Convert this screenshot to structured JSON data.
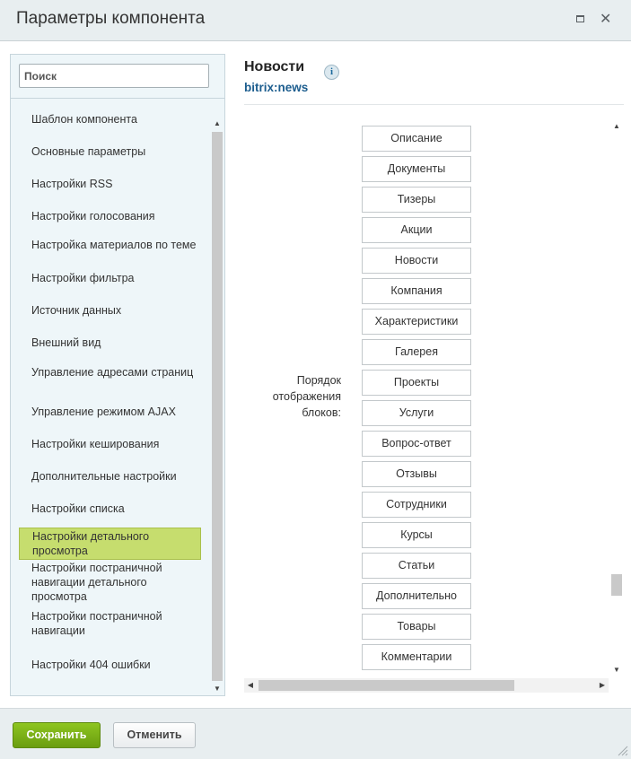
{
  "window": {
    "title": "Параметры компонента"
  },
  "sidebar": {
    "search_placeholder": "Поиск",
    "items": [
      {
        "label": "Шаблон компонента"
      },
      {
        "label": "Основные параметры"
      },
      {
        "label": "Настройки RSS"
      },
      {
        "label": "Настройки голосования"
      },
      {
        "label": "Настройка материалов по теме"
      },
      {
        "label": "Настройки фильтра"
      },
      {
        "label": "Источник данных"
      },
      {
        "label": "Внешний вид"
      },
      {
        "label": "Управление адресами страниц"
      },
      {
        "label": "Управление режимом AJAX"
      },
      {
        "label": "Настройки кеширования"
      },
      {
        "label": "Дополнительные настройки"
      },
      {
        "label": "Настройки списка"
      },
      {
        "label": "Настройки детального просмотра",
        "active": true
      },
      {
        "label": "Настройки постраничной навигации детального просмотра"
      },
      {
        "label": "Настройки постраничной навигации"
      },
      {
        "label": "Настройки 404 ошибки"
      }
    ]
  },
  "main": {
    "title": "Новости",
    "subtitle": "bitrix:news",
    "info_icon": "info-icon",
    "block_order_label": "Порядок отображения блоков:",
    "blocks": [
      "Описание",
      "Документы",
      "Тизеры",
      "Акции",
      "Новости",
      "Компания",
      "Характеристики",
      "Галерея",
      "Проекты",
      "Услуги",
      "Вопрос-ответ",
      "Отзывы",
      "Сотрудники",
      "Курсы",
      "Статьи",
      "Дополнительно",
      "Товары",
      "Комментарии"
    ]
  },
  "footer": {
    "save_label": "Сохранить",
    "cancel_label": "Отменить"
  },
  "colors": {
    "save_button": "#7ab319",
    "active_item": "#c6dd6e",
    "subtitle": "#1c5d8e"
  }
}
